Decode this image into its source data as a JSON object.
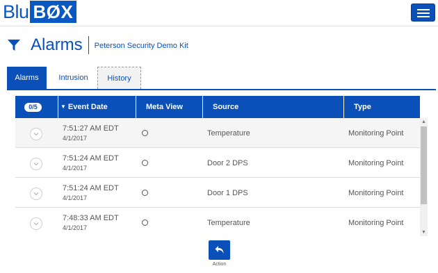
{
  "header": {
    "logo_blu": "Blu",
    "logo_box": "BØX",
    "menu_icon": "hamburger-icon"
  },
  "page": {
    "title": "Alarms",
    "filter_icon": "filter-icon",
    "kit_name": "Peterson Security Demo Kit"
  },
  "tabs": [
    {
      "label": "Alarms",
      "active": true
    },
    {
      "label": "Intrusion",
      "active": false
    },
    {
      "label": "History",
      "active": false
    }
  ],
  "table": {
    "count_badge": "0/5",
    "columns": {
      "event_date": "Event Date",
      "meta_view": "Meta View",
      "source": "Source",
      "type": "Type"
    },
    "rows": [
      {
        "time": "7:51:27 AM EDT",
        "date": "4/1/2017",
        "source": "Temperature",
        "type": "Monitoring Point"
      },
      {
        "time": "7:51:24 AM EDT",
        "date": "4/1/2017",
        "source": "Door 2 DPS",
        "type": "Monitoring Point"
      },
      {
        "time": "7:51:24 AM EDT",
        "date": "4/1/2017",
        "source": "Door 1 DPS",
        "type": "Monitoring Point"
      },
      {
        "time": "7:48:33 AM EDT",
        "date": "4/1/2017",
        "source": "Temperature",
        "type": "Monitoring Point"
      }
    ]
  },
  "action": {
    "label": "Action",
    "icon": "reply-arrow-icon"
  },
  "colors": {
    "primary": "#0a50b8",
    "logo": "#0a58c2",
    "row_alt": "#f5f5f5"
  }
}
